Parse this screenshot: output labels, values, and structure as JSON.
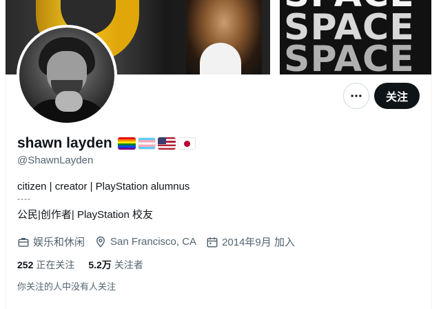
{
  "banner": {
    "text_lines": [
      "SPACE",
      "SPACE",
      "SPACE"
    ]
  },
  "actions": {
    "more_icon": "more-horizontal-icon",
    "follow_label": "关注"
  },
  "profile": {
    "display_name": "shawn layden",
    "flags": [
      "rainbow-flag",
      "transgender-flag",
      "us-flag",
      "japan-flag"
    ],
    "handle": "@ShawnLayden",
    "bio_line1": "citizen | creator | PlayStation alumnus",
    "bio_separator": "----",
    "bio_line2": "公民|创作者| PlayStation 校友"
  },
  "meta": {
    "category": "娱乐和休闲",
    "location": "San Francisco, CA",
    "joined": "2014年9月 加入"
  },
  "stats": {
    "following_count": "252",
    "following_label": "正在关注",
    "followers_count": "5.2万",
    "followers_label": "关注者"
  },
  "followers_you_know": "你关注的人中没有人关注",
  "colors": {
    "text_primary": "#0f1419",
    "text_secondary": "#536471",
    "button_dark": "#0f1419",
    "border": "#cfd9de"
  }
}
